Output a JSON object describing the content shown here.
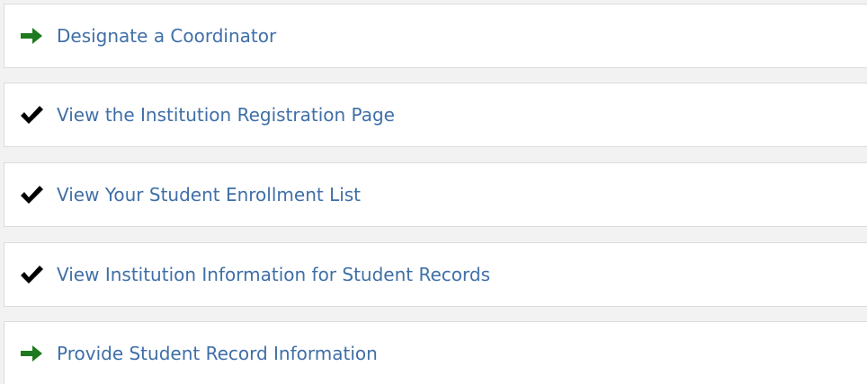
{
  "tasks": [
    {
      "label": "Designate a Coordinator",
      "status_icon": "arrow-right-icon",
      "icon_color": "#1e7a1e"
    },
    {
      "label": "View the Institution Registration Page",
      "status_icon": "checkmark-icon",
      "icon_color": "#000000"
    },
    {
      "label": "View Your Student Enrollment List",
      "status_icon": "checkmark-icon",
      "icon_color": "#000000"
    },
    {
      "label": "View Institution Information for Student Records",
      "status_icon": "checkmark-icon",
      "icon_color": "#000000"
    },
    {
      "label": "Provide Student Record Information",
      "status_icon": "arrow-right-icon",
      "icon_color": "#1e7a1e"
    }
  ],
  "colors": {
    "link": "#3f6fa7",
    "card_border": "#dcdcdc",
    "background": "#f2f2f2"
  }
}
